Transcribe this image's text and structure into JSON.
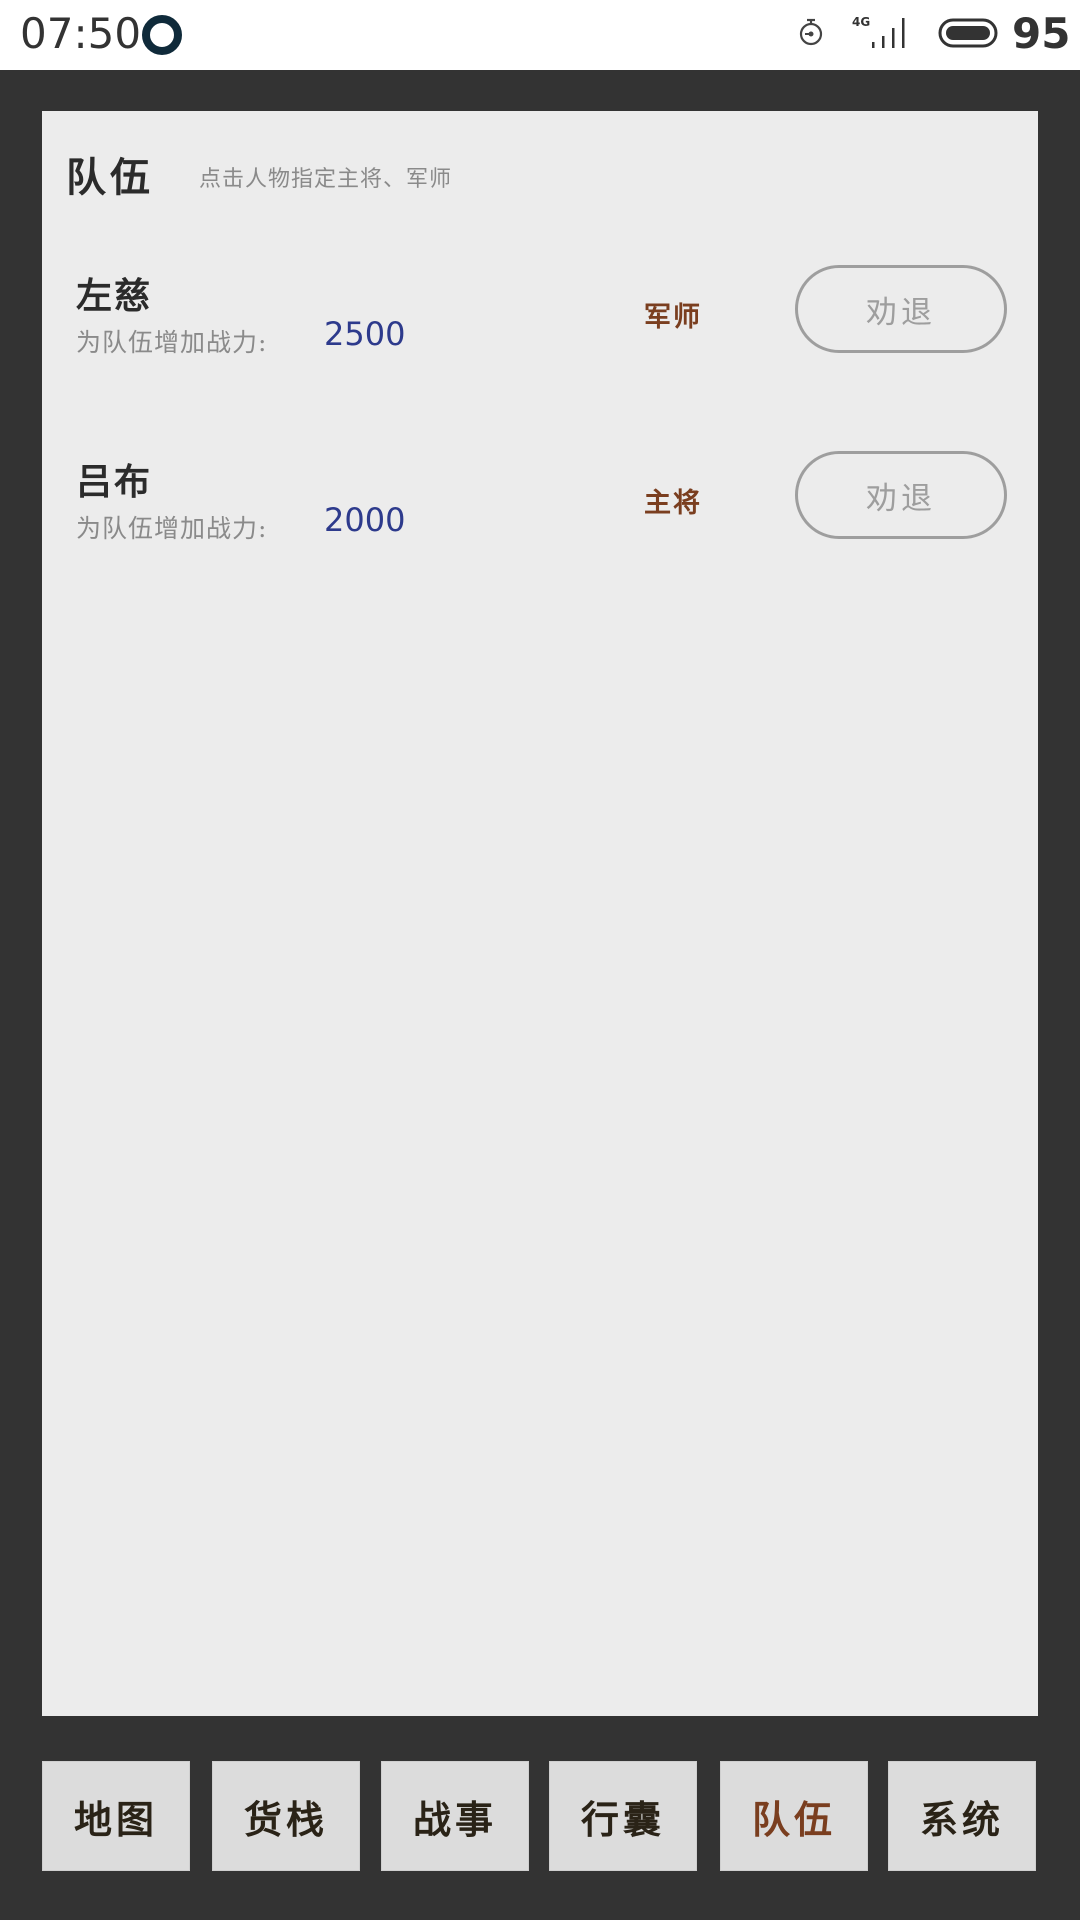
{
  "status_bar": {
    "time": "07:50",
    "network": "4G",
    "battery_level": "95",
    "icons": [
      "ring-icon",
      "timer-icon",
      "signal-icon",
      "battery-icon"
    ]
  },
  "panel": {
    "title": "队伍",
    "hint": "点击人物指定主将、军师"
  },
  "members": [
    {
      "name": "左慈",
      "power_label": "为队伍增加战力:",
      "power_value": "2500",
      "role": "军师",
      "dismiss_label": "劝退"
    },
    {
      "name": "吕布",
      "power_label": "为队伍增加战力:",
      "power_value": "2000",
      "role": "主将",
      "dismiss_label": "劝退"
    }
  ],
  "bottom_nav": {
    "items": [
      {
        "label": "地图",
        "active": false
      },
      {
        "label": "货栈",
        "active": false
      },
      {
        "label": "战事",
        "active": false
      },
      {
        "label": "行囊",
        "active": false
      },
      {
        "label": "队伍",
        "active": true
      },
      {
        "label": "系统",
        "active": false
      }
    ]
  },
  "colors": {
    "background": "#333333",
    "panel": "#ececec",
    "role": "#7a3e1f",
    "power_value": "#2d3a8c",
    "active_nav": "#7a3e1f"
  }
}
